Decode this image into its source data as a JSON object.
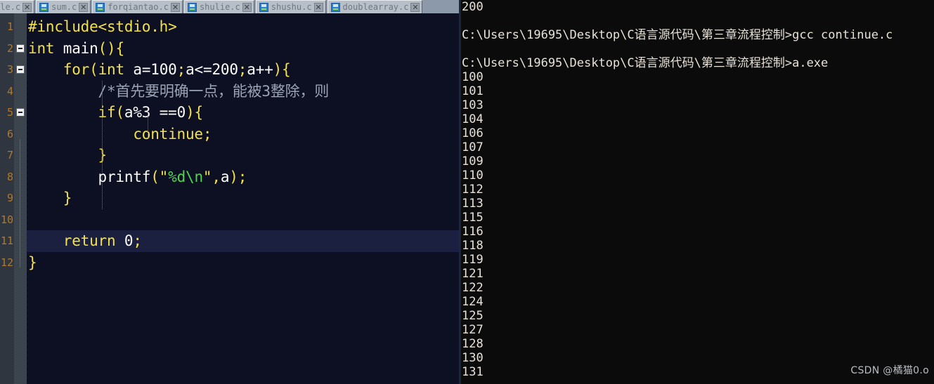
{
  "tabs": [
    {
      "label": "ile.c",
      "icon": "save-file-icon",
      "close": "✕",
      "partial": true
    },
    {
      "label": "sum.c",
      "icon": "save-file-icon",
      "close": "✕",
      "partial": false
    },
    {
      "label": "forqiantao.c",
      "icon": "save-file-icon",
      "close": "✕",
      "partial": false
    },
    {
      "label": "shulie.c",
      "icon": "save-file-icon",
      "close": "✕",
      "partial": false
    },
    {
      "label": "shushu.c",
      "icon": "save-file-icon",
      "close": "✕",
      "partial": false
    },
    {
      "label": "doublearray.c",
      "icon": "save-file-icon",
      "close": "✕",
      "partial": true
    }
  ],
  "editor": {
    "line_numbers": [
      "1",
      "2",
      "3",
      "4",
      "5",
      "6",
      "7",
      "8",
      "9",
      "10",
      "11",
      "12"
    ],
    "current_line": 11,
    "fold_markers": [
      2,
      3,
      5
    ],
    "lines": [
      {
        "n": 1,
        "indent": 0,
        "text": "#include<stdio.h>"
      },
      {
        "n": 2,
        "indent": 0,
        "text": "int main(){"
      },
      {
        "n": 3,
        "indent": 1,
        "text": "for(int a=100;a<=200;a++){"
      },
      {
        "n": 4,
        "indent": 2,
        "text": "/*首先要明确一点，能被3整除，则"
      },
      {
        "n": 5,
        "indent": 2,
        "text": "if(a%3 ==0){"
      },
      {
        "n": 6,
        "indent": 3,
        "text": "continue;"
      },
      {
        "n": 7,
        "indent": 2,
        "text": "}"
      },
      {
        "n": 8,
        "indent": 2,
        "text": "printf(\"%d\\n\",a);"
      },
      {
        "n": 9,
        "indent": 1,
        "text": "}"
      },
      {
        "n": 10,
        "indent": 0,
        "text": ""
      },
      {
        "n": 11,
        "indent": 1,
        "text": "return 0;"
      },
      {
        "n": 12,
        "indent": 0,
        "text": "}"
      }
    ]
  },
  "console": {
    "lines": [
      "200",
      "",
      "C:\\Users\\19695\\Desktop\\C语言源代码\\第三章流程控制>gcc continue.c",
      "",
      "C:\\Users\\19695\\Desktop\\C语言源代码\\第三章流程控制>a.exe",
      "100",
      "101",
      "103",
      "104",
      "106",
      "107",
      "109",
      "110",
      "112",
      "113",
      "115",
      "116",
      "118",
      "119",
      "121",
      "122",
      "124",
      "125",
      "127",
      "128",
      "130",
      "131"
    ],
    "prompt_path": "C:\\Users\\19695\\Desktop\\C语言源代码\\第三章流程控制",
    "commands": [
      "gcc continue.c",
      "a.exe"
    ],
    "program_output": [
      "200",
      "100",
      "101",
      "103",
      "104",
      "106",
      "107",
      "109",
      "110",
      "112",
      "113",
      "115",
      "116",
      "118",
      "119",
      "121",
      "122",
      "124",
      "125",
      "127",
      "128",
      "130",
      "131"
    ]
  },
  "watermark": {
    "text": "CSDN @橘猫0.o"
  },
  "colors": {
    "editor_bg": "#0d0f23",
    "current_line_bg": "#1b2040",
    "gutter_bg": "#2f3640",
    "fold_bg": "#3a424c",
    "keyword": "#f2e14c",
    "identifier": "#ffffff",
    "string": "#4fd64f",
    "comment": "#9aa4b2",
    "line_number": "#b0792e",
    "tabbar_bg": "#8c99ab",
    "tab_bg": "#b7bfc9",
    "tab_label": "#6f7780",
    "console_bg": "#0b0b0b",
    "console_text": "#e8e2d8",
    "watermark": "#b9bec4"
  }
}
